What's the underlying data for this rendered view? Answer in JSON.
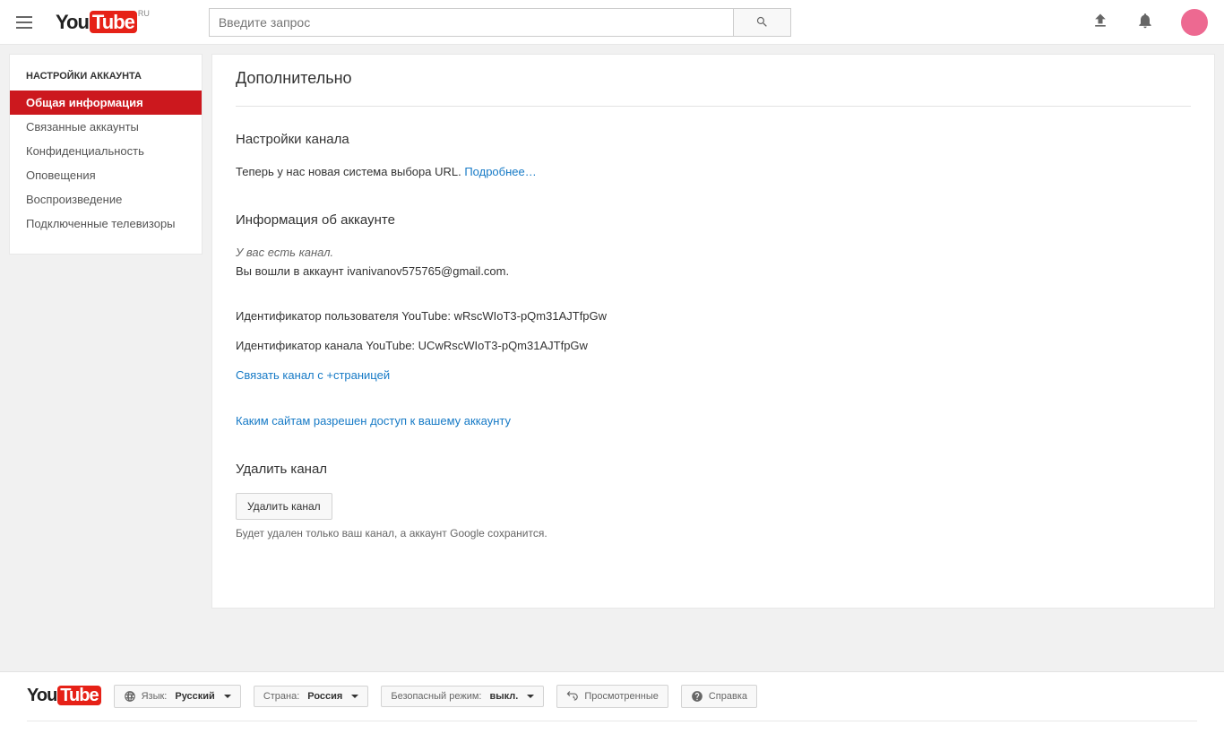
{
  "header": {
    "search_placeholder": "Введите запрос",
    "region": "RU"
  },
  "sidebar": {
    "title": "НАСТРОЙКИ АККАУНТА",
    "items": [
      {
        "label": "Общая информация",
        "active": true
      },
      {
        "label": "Связанные аккаунты",
        "active": false
      },
      {
        "label": "Конфиденциальность",
        "active": false
      },
      {
        "label": "Оповещения",
        "active": false
      },
      {
        "label": "Воспроизведение",
        "active": false
      },
      {
        "label": "Подключенные телевизоры",
        "active": false
      }
    ]
  },
  "content": {
    "title": "Дополнительно",
    "channel_settings_heading": "Настройки канала",
    "url_text": "Теперь у нас новая система выбора URL. ",
    "url_link": "Подробнее…",
    "account_info_heading": "Информация об аккаунте",
    "have_channel": "У вас есть канал.",
    "logged_in_prefix": "Вы вошли в аккаунт ",
    "logged_in_email": "ivanivanov575765@gmail.com",
    "logged_in_suffix": ".",
    "user_id_label": "Идентификатор пользователя YouTube: ",
    "user_id": "wRscWIoT3-pQm31AJTfpGw",
    "channel_id_label": "Идентификатор канала YouTube: ",
    "channel_id": "UCwRscWIoT3-pQm31AJTfpGw",
    "link_plus": "Связать канал с +страницей",
    "allowed_sites": "Каким сайтам разрешен доступ к вашему аккаунту",
    "delete_heading": "Удалить канал",
    "delete_button": "Удалить канал",
    "delete_note": "Будет удален только ваш канал, а аккаунт Google сохранится."
  },
  "footer": {
    "lang_label": "Язык:",
    "lang_value": "Русский",
    "country_label": "Страна:",
    "country_value": "Россия",
    "safe_label": "Безопасный режим:",
    "safe_value": "выкл.",
    "history": "Просмотренные",
    "help": "Справка"
  }
}
